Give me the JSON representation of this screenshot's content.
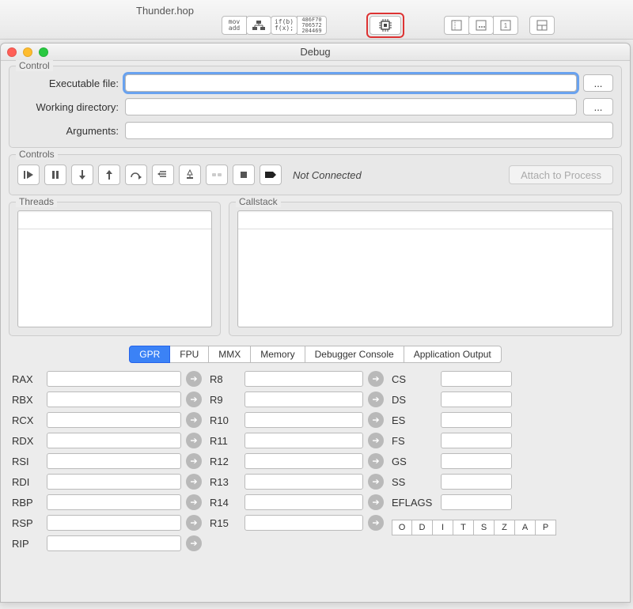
{
  "top": {
    "file_title": "Thunder.hop",
    "group1": {
      "mov": "mov",
      "add": "add",
      "ifb": "if(b)",
      "fx": "f(x);",
      "hex": "486F70\n706572\n204469"
    }
  },
  "window": {
    "title": "Debug"
  },
  "control_section": {
    "legend": "Control",
    "exec_label": "Executable file:",
    "exec_value": "",
    "workdir_label": "Working directory:",
    "workdir_value": "",
    "args_label": "Arguments:",
    "args_value": "",
    "browse": "..."
  },
  "controls_section": {
    "legend": "Controls",
    "status": "Not Connected",
    "attach": "Attach to Process"
  },
  "threads_section": {
    "legend": "Threads"
  },
  "callstack_section": {
    "legend": "Callstack"
  },
  "tabs": [
    "GPR",
    "FPU",
    "MMX",
    "Memory",
    "Debugger Console",
    "Application Output"
  ],
  "regs_col1": [
    "RAX",
    "RBX",
    "RCX",
    "RDX",
    "RSI",
    "RDI",
    "RBP",
    "RSP",
    "RIP"
  ],
  "regs_col2": [
    "R8",
    "R9",
    "R10",
    "R11",
    "R12",
    "R13",
    "R14",
    "R15"
  ],
  "regs_col3": [
    "CS",
    "DS",
    "ES",
    "FS",
    "GS",
    "SS",
    "EFLAGS"
  ],
  "flags": [
    "O",
    "D",
    "I",
    "T",
    "S",
    "Z",
    "A",
    "P"
  ]
}
